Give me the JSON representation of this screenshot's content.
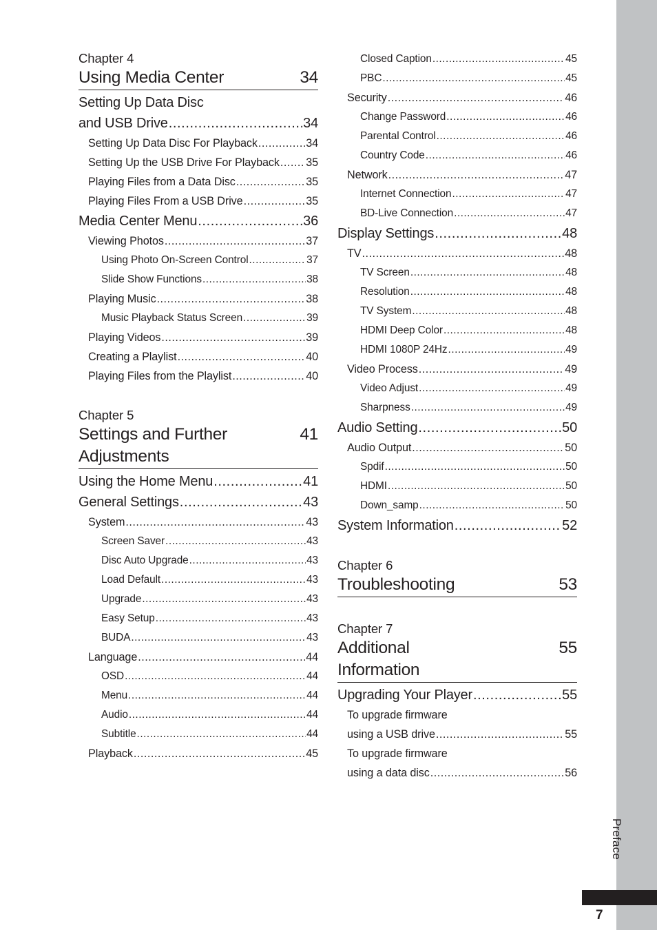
{
  "folio": "7",
  "edge_label": "Preface",
  "dot_leader": "..............................................................................................",
  "left_column": [
    {
      "kind": "chapter",
      "name": "chapter-4",
      "kicker": "Chapter 4",
      "title": "Using Media Center",
      "page": "34"
    },
    {
      "kind": "entry",
      "level": 1,
      "label": "Setting Up Data Disc\nand USB Drive",
      "page": "34",
      "wrap": true,
      "first_line": "Setting Up Data Disc",
      "last_line": "and USB Drive"
    },
    {
      "kind": "entry",
      "level": 2,
      "label": "Setting Up Data Disc For Playback",
      "page": "34"
    },
    {
      "kind": "entry",
      "level": 2,
      "label": "Setting Up the USB Drive For Playback",
      "page": "35"
    },
    {
      "kind": "entry",
      "level": 2,
      "label": "Playing Files from a Data Disc",
      "page": "35"
    },
    {
      "kind": "entry",
      "level": 2,
      "label": "Playing Files From a USB Drive",
      "page": "35"
    },
    {
      "kind": "entry",
      "level": 1,
      "label": "Media Center Menu",
      "page": "36"
    },
    {
      "kind": "entry",
      "level": 2,
      "label": "Viewing Photos",
      "page": "37"
    },
    {
      "kind": "entry",
      "level": 3,
      "label": "Using Photo On-Screen Control",
      "page": "37"
    },
    {
      "kind": "entry",
      "level": 3,
      "label": "Slide Show Functions",
      "page": "38"
    },
    {
      "kind": "entry",
      "level": 2,
      "label": "Playing Music",
      "page": "38"
    },
    {
      "kind": "entry",
      "level": 3,
      "label": "Music Playback Status Screen",
      "page": "39"
    },
    {
      "kind": "entry",
      "level": 2,
      "label": "Playing Videos",
      "page": "39"
    },
    {
      "kind": "entry",
      "level": 2,
      "label": "Creating a Playlist",
      "page": "40"
    },
    {
      "kind": "entry",
      "level": 2,
      "label": "Playing Files from the Playlist",
      "page": "40"
    },
    {
      "kind": "chapter",
      "name": "chapter-5",
      "kicker": "Chapter 5",
      "title": "Settings and Further\nAdjustments",
      "page": "41"
    },
    {
      "kind": "entry",
      "level": 1,
      "label": "Using the Home Menu",
      "page": "41"
    },
    {
      "kind": "entry",
      "level": 1,
      "label": "General Settings",
      "page": "43"
    },
    {
      "kind": "entry",
      "level": 2,
      "label": "System",
      "page": "43"
    },
    {
      "kind": "entry",
      "level": 3,
      "label": "Screen Saver",
      "page": "43"
    },
    {
      "kind": "entry",
      "level": 3,
      "label": "Disc Auto Upgrade",
      "page": "43"
    },
    {
      "kind": "entry",
      "level": 3,
      "label": "Load Default",
      "page": "43"
    },
    {
      "kind": "entry",
      "level": 3,
      "label": "Upgrade",
      "page": "43"
    },
    {
      "kind": "entry",
      "level": 3,
      "label": "Easy Setup",
      "page": "43"
    },
    {
      "kind": "entry",
      "level": 3,
      "label": "BUDA",
      "page": "43"
    },
    {
      "kind": "entry",
      "level": 2,
      "label": "Language",
      "page": "44"
    },
    {
      "kind": "entry",
      "level": 3,
      "label": "OSD",
      "page": "44"
    },
    {
      "kind": "entry",
      "level": 3,
      "label": "Menu",
      "page": "44"
    },
    {
      "kind": "entry",
      "level": 3,
      "label": "Audio",
      "page": "44"
    },
    {
      "kind": "entry",
      "level": 3,
      "label": "Subtitle",
      "page": "44"
    },
    {
      "kind": "entry",
      "level": 2,
      "label": "Playback",
      "page": "45"
    }
  ],
  "right_column": [
    {
      "kind": "entry",
      "level": 3,
      "label": "Closed Caption",
      "page": "45"
    },
    {
      "kind": "entry",
      "level": 3,
      "label": "PBC",
      "page": "45"
    },
    {
      "kind": "entry",
      "level": 2,
      "label": "Security",
      "page": "46"
    },
    {
      "kind": "entry",
      "level": 3,
      "label": "Change Password",
      "page": "46"
    },
    {
      "kind": "entry",
      "level": 3,
      "label": "Parental Control",
      "page": "46"
    },
    {
      "kind": "entry",
      "level": 3,
      "label": "Country Code",
      "page": "46"
    },
    {
      "kind": "entry",
      "level": 2,
      "label": "Network",
      "page": "47"
    },
    {
      "kind": "entry",
      "level": 3,
      "label": "Internet Connection",
      "page": "47"
    },
    {
      "kind": "entry",
      "level": 3,
      "label": "BD-Live Connection",
      "page": "47"
    },
    {
      "kind": "entry",
      "level": 1,
      "label": "Display Settings",
      "page": "48"
    },
    {
      "kind": "entry",
      "level": 2,
      "label": "TV",
      "page": "48"
    },
    {
      "kind": "entry",
      "level": 3,
      "label": "TV Screen",
      "page": "48"
    },
    {
      "kind": "entry",
      "level": 3,
      "label": "Resolution",
      "page": "48"
    },
    {
      "kind": "entry",
      "level": 3,
      "label": "TV System",
      "page": "48"
    },
    {
      "kind": "entry",
      "level": 3,
      "label": "HDMI Deep Color",
      "page": "48"
    },
    {
      "kind": "entry",
      "level": 3,
      "label": "HDMI 1080P 24Hz",
      "page": "49"
    },
    {
      "kind": "entry",
      "level": 2,
      "label": "Video Process",
      "page": "49"
    },
    {
      "kind": "entry",
      "level": 3,
      "label": "Video Adjust",
      "page": "49"
    },
    {
      "kind": "entry",
      "level": 3,
      "label": "Sharpness",
      "page": "49"
    },
    {
      "kind": "entry",
      "level": 1,
      "label": "Audio Setting",
      "page": "50"
    },
    {
      "kind": "entry",
      "level": 2,
      "label": "Audio Output",
      "page": "50"
    },
    {
      "kind": "entry",
      "level": 3,
      "label": "Spdif",
      "page": "50"
    },
    {
      "kind": "entry",
      "level": 3,
      "label": "HDMI",
      "page": "50"
    },
    {
      "kind": "entry",
      "level": 3,
      "label": "Down_samp",
      "page": "50"
    },
    {
      "kind": "entry",
      "level": 1,
      "label": "System Information",
      "page": "52"
    },
    {
      "kind": "chapter",
      "name": "chapter-6",
      "kicker": "Chapter 6",
      "title": "Troubleshooting",
      "page": "53"
    },
    {
      "kind": "chapter",
      "name": "chapter-7",
      "kicker": "Chapter 7",
      "title": "Additional\nInformation",
      "page": "55"
    },
    {
      "kind": "entry",
      "level": 1,
      "label": "Upgrading Your Player",
      "page": "55"
    },
    {
      "kind": "entry",
      "level": 2,
      "label": "To upgrade firmware\nusing a USB drive",
      "page": "55",
      "wrap": true,
      "first_line": "To upgrade firmware",
      "last_line": "using a USB drive"
    },
    {
      "kind": "entry",
      "level": 2,
      "label": "To upgrade firmware\nusing a data disc",
      "page": "56",
      "wrap": true,
      "first_line": "To upgrade firmware",
      "last_line": "using a data disc"
    }
  ]
}
